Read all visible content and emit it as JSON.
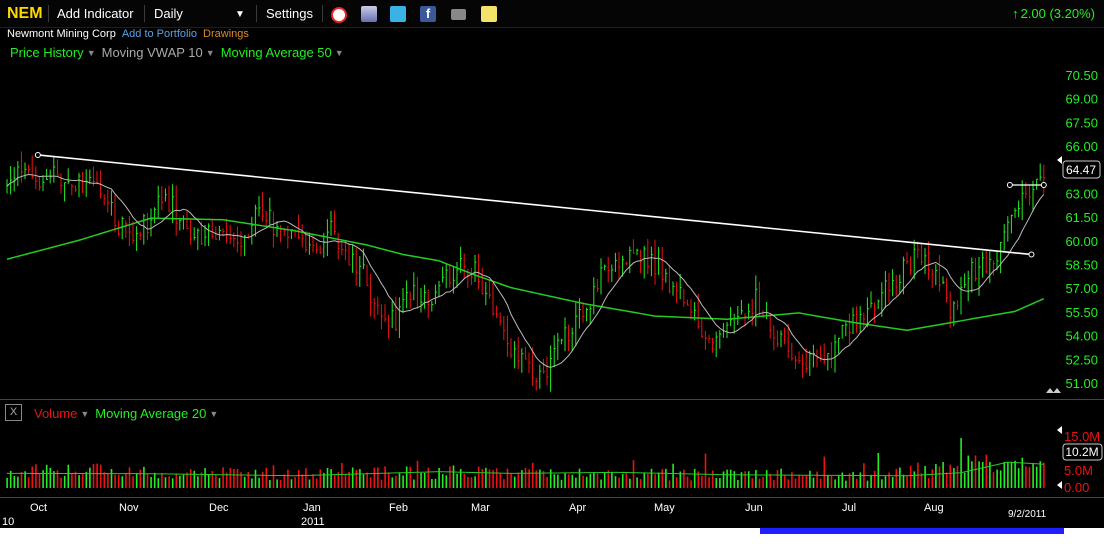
{
  "toolbar": {
    "symbol": "NEM",
    "add_indicator": "Add Indicator",
    "period": "Daily",
    "settings": "Settings",
    "change": "2.00 (3.20%)",
    "icons": [
      "alarm-clock-icon",
      "notes-icon",
      "twitter-icon",
      "facebook-icon",
      "camera-icon",
      "sticky-note-icon"
    ]
  },
  "subbar": {
    "company": "Newmont Mining Corp",
    "add_portfolio": "Add to Portfolio",
    "drawings": "Drawings"
  },
  "colors": {
    "background": "#000000",
    "up": "#22ee22",
    "down": "#ee1111",
    "vwap": "#bbbbbb",
    "ma": "#22cc22",
    "trendline": "#ffffff",
    "axis_text": "#22ee22",
    "symbol": "#ffd800"
  },
  "price_legend": {
    "price_history": "Price History",
    "vwap": "Moving VWAP 10",
    "ma": "Moving Average 50"
  },
  "volume_legend": {
    "volume": "Volume",
    "ma": "Moving Average 20"
  },
  "volume_panel": {
    "close_label": "X"
  },
  "chart_data": {
    "type": "ohlc",
    "title": "NEM",
    "interval": "Daily",
    "price_axis": {
      "ticks": [
        "70.50",
        "69.00",
        "67.50",
        "66.00",
        "64.50",
        "63.00",
        "61.50",
        "60.00",
        "58.50",
        "57.00",
        "55.50",
        "54.00",
        "52.50",
        "51.00"
      ],
      "ylim": [
        49.9,
        71.2
      ],
      "last_price_label": "64.47"
    },
    "volume_axis": {
      "ticks": [
        "15.0M",
        "5.0M",
        "0.00"
      ],
      "ylim": [
        0,
        17000000
      ],
      "last_volume_label": "10.2M"
    },
    "x_axis": {
      "months": [
        "10",
        "Oct",
        "Nov",
        "Dec",
        "Jan",
        "2011",
        "Feb",
        "Mar",
        "Apr",
        "May",
        "Jun",
        "Jul",
        "Aug",
        "9/2/2011"
      ]
    },
    "trend_line": {
      "start": [
        "2010-10-11",
        65.5
      ],
      "end": [
        "2011-08-29",
        59.2
      ]
    },
    "short_line": {
      "start": [
        "2011-08-22",
        63.6
      ],
      "end": [
        "2011-09-02",
        63.6
      ]
    },
    "price_path": [
      [
        0,
        64.0
      ],
      [
        12,
        64.2
      ],
      [
        20,
        63.8
      ],
      [
        28,
        62.9
      ],
      [
        30,
        61.1
      ],
      [
        36,
        60.7
      ],
      [
        40,
        61.4
      ],
      [
        44,
        63.1
      ],
      [
        48,
        61.3
      ],
      [
        55,
        60.1
      ],
      [
        60,
        61.3
      ],
      [
        63,
        59.8
      ],
      [
        67,
        60.8
      ],
      [
        70,
        62.7
      ],
      [
        75,
        60.4
      ],
      [
        80,
        61.0
      ],
      [
        85,
        59.4
      ],
      [
        90,
        60.7
      ],
      [
        93,
        59.6
      ],
      [
        100,
        57.9
      ],
      [
        102,
        55.5
      ],
      [
        108,
        55.1
      ],
      [
        112,
        56.9
      ],
      [
        116,
        56.2
      ],
      [
        121,
        57.5
      ],
      [
        126,
        58.6
      ],
      [
        130,
        58.1
      ],
      [
        135,
        55.5
      ],
      [
        140,
        53.4
      ],
      [
        144,
        52.2
      ],
      [
        147,
        51.1
      ],
      [
        150,
        51.9
      ],
      [
        153,
        53.3
      ],
      [
        157,
        54.6
      ],
      [
        160,
        55.5
      ],
      [
        165,
        57.9
      ],
      [
        170,
        58.8
      ],
      [
        175,
        59.4
      ],
      [
        180,
        58.6
      ],
      [
        184,
        57.4
      ],
      [
        187,
        56.7
      ],
      [
        190,
        55.5
      ],
      [
        195,
        53.5
      ],
      [
        200,
        54.4
      ],
      [
        205,
        55.4
      ],
      [
        208,
        56.3
      ],
      [
        214,
        54.1
      ],
      [
        218,
        53.1
      ],
      [
        224,
        52.3
      ],
      [
        228,
        52.7
      ],
      [
        232,
        54.3
      ],
      [
        236,
        54.8
      ],
      [
        240,
        55.5
      ],
      [
        246,
        57.5
      ],
      [
        250,
        58.6
      ],
      [
        254,
        59.1
      ],
      [
        258,
        58.1
      ],
      [
        262,
        55.5
      ],
      [
        264,
        56.6
      ],
      [
        268,
        58.1
      ],
      [
        272,
        58.8
      ],
      [
        276,
        59.3
      ],
      [
        278,
        61.3
      ],
      [
        281,
        62.4
      ],
      [
        284,
        62.9
      ],
      [
        286,
        63.6
      ],
      [
        288,
        64.3
      ]
    ],
    "ma50_path": [
      [
        0,
        58.9
      ],
      [
        20,
        60.1
      ],
      [
        40,
        61.5
      ],
      [
        60,
        61.4
      ],
      [
        80,
        60.7
      ],
      [
        100,
        59.8
      ],
      [
        110,
        59.2
      ],
      [
        120,
        58.8
      ],
      [
        130,
        57.9
      ],
      [
        140,
        57.1
      ],
      [
        160,
        56.1
      ],
      [
        180,
        55.3
      ],
      [
        200,
        55.1
      ],
      [
        220,
        55.5
      ],
      [
        235,
        54.9
      ],
      [
        250,
        54.4
      ],
      [
        265,
        55.0
      ],
      [
        280,
        55.6
      ],
      [
        288,
        56.4
      ]
    ],
    "volume_profile": [
      [
        0,
        4.3
      ],
      [
        25,
        5.0
      ],
      [
        45,
        4.4
      ],
      [
        80,
        4.2
      ],
      [
        110,
        4.4
      ],
      [
        125,
        4.6
      ],
      [
        140,
        4.3
      ],
      [
        160,
        4.1
      ],
      [
        180,
        4.1
      ],
      [
        200,
        3.8
      ],
      [
        220,
        3.7
      ],
      [
        240,
        3.9
      ],
      [
        255,
        4.8
      ],
      [
        270,
        7.4
      ],
      [
        288,
        7.3
      ]
    ],
    "volume_ma_path": [
      [
        0,
        4.3
      ],
      [
        40,
        4.2
      ],
      [
        80,
        3.6
      ],
      [
        100,
        4.2
      ],
      [
        120,
        4.8
      ],
      [
        140,
        4.3
      ],
      [
        170,
        4.6
      ],
      [
        200,
        3.9
      ],
      [
        230,
        3.7
      ],
      [
        250,
        3.6
      ],
      [
        265,
        4.5
      ],
      [
        278,
        7.6
      ],
      [
        288,
        7.0
      ]
    ]
  }
}
